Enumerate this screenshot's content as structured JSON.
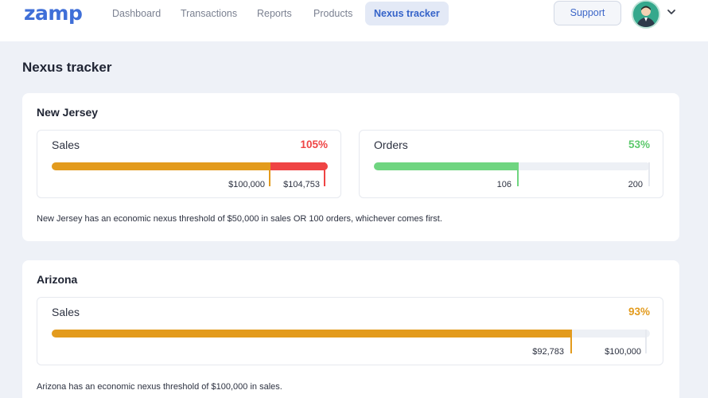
{
  "header": {
    "logo": "zamp",
    "nav": [
      {
        "label": "Dashboard"
      },
      {
        "label": "Transactions"
      },
      {
        "label": "Reports"
      },
      {
        "label": "Products"
      },
      {
        "label": "Nexus tracker",
        "active": true
      }
    ],
    "support_label": "Support",
    "avatar_icon": "user-avatar-icon",
    "menu_icon": "chevron-down-icon"
  },
  "page": {
    "title": "Nexus tracker"
  },
  "colors": {
    "accent": "#3563c9",
    "orange": "#e39b1d",
    "red": "#ef4444",
    "green": "#6fd580",
    "track": "#edf0f5"
  },
  "states": [
    {
      "name": "New Jersey",
      "metrics": [
        {
          "label": "Sales",
          "percent_label": "105%",
          "progress_percent": 105,
          "status_color": "#ef4444",
          "threshold_label": "$100,000",
          "current_label": "$104,753"
        },
        {
          "label": "Orders",
          "percent_label": "53%",
          "progress_percent": 53,
          "status_color": "#5dc96d",
          "current_label": "106",
          "threshold_label": "200"
        }
      ],
      "note": "New Jersey has an economic nexus threshold of $50,000 in sales OR 100 orders, whichever comes first."
    },
    {
      "name": "Arizona",
      "metrics": [
        {
          "label": "Sales",
          "percent_label": "93%",
          "progress_percent": 93,
          "status_color": "#e39b1d",
          "current_label": "$92,783",
          "threshold_label": "$100,000"
        }
      ],
      "note": "Arizona has an economic nexus threshold of $100,000 in sales."
    }
  ]
}
